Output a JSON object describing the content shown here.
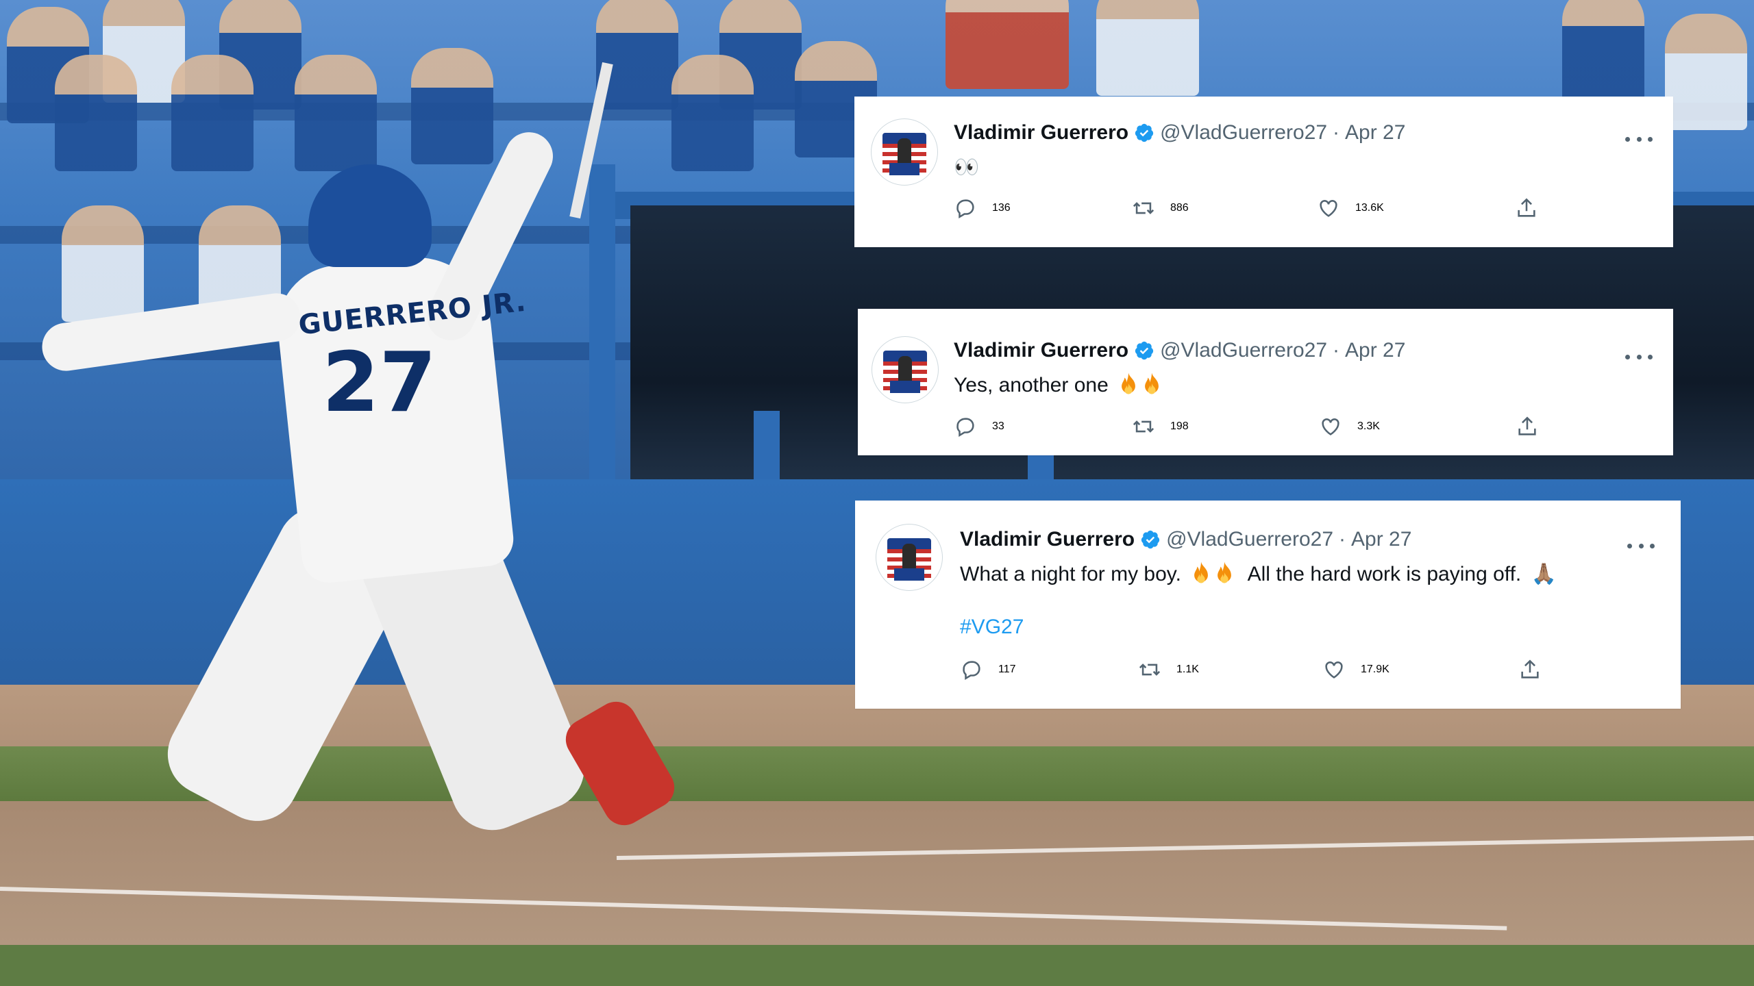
{
  "tweets": [
    {
      "author_name": "Vladimir Guerrero",
      "handle": "@VladGuerrero27",
      "separator": "·",
      "date": "Apr 27",
      "text": "👀",
      "hashtag": "",
      "counts": {
        "replies": "136",
        "retweets": "886",
        "likes": "13.6K"
      }
    },
    {
      "author_name": "Vladimir Guerrero",
      "handle": "@VladGuerrero27",
      "separator": "·",
      "date": "Apr 27",
      "text": "Yes, another one",
      "hashtag": "",
      "counts": {
        "replies": "33",
        "retweets": "198",
        "likes": "3.3K"
      }
    },
    {
      "author_name": "Vladimir Guerrero",
      "handle": "@VladGuerrero27",
      "separator": "·",
      "date": "Apr 27",
      "text_part1": "What a night for my boy.",
      "text_part2": "All the hard work is paying off.",
      "text_emoji_end": "🙏🏽",
      "hashtag": "#VG27",
      "counts": {
        "replies": "117",
        "retweets": "1.1K",
        "likes": "17.9K"
      }
    }
  ],
  "background": {
    "jersey_name": "GUERRERO JR.",
    "jersey_number": "27"
  },
  "icons": [
    "verified-badge-icon",
    "more-options-icon",
    "reply-icon",
    "retweet-icon",
    "like-icon",
    "share-icon",
    "fire-emoji-icon"
  ],
  "colors": {
    "verified": "#1d9bf0",
    "text": "#0f1419",
    "secondary": "#536471",
    "link": "#1d9bf0"
  }
}
